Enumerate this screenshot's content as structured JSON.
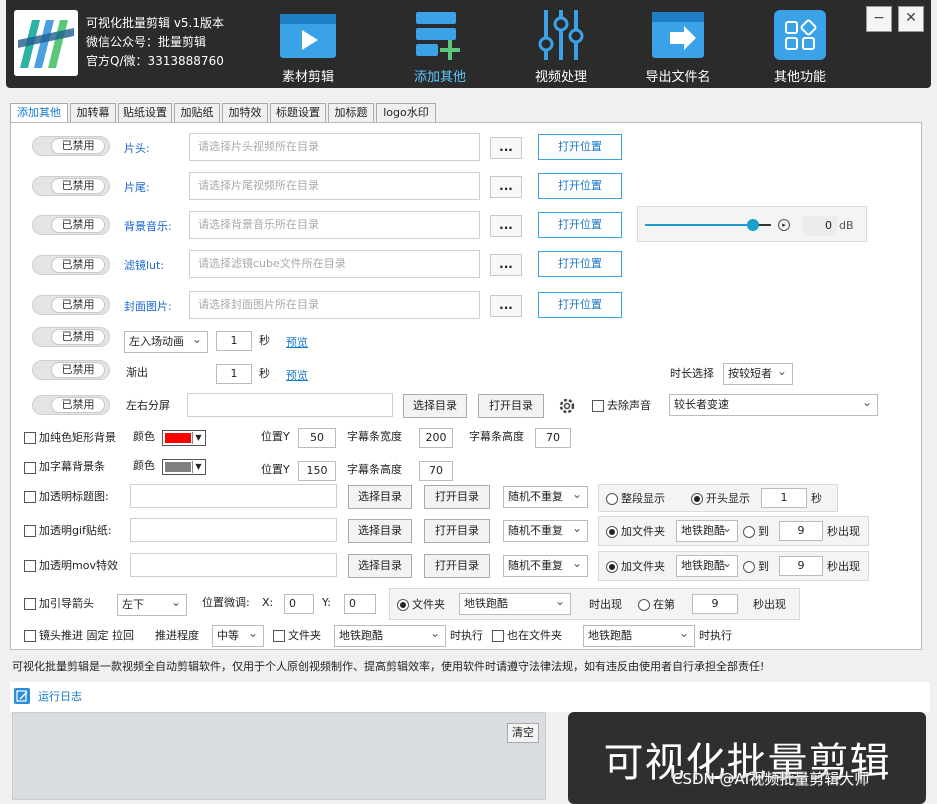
{
  "header": {
    "app_title": "可视化批量剪辑 v5.1版本",
    "wechat": "微信公众号：批量剪辑",
    "contact": "官方Q/微：3313888760",
    "nav": [
      {
        "label": "素材剪辑",
        "icon": "video-play-icon"
      },
      {
        "label": "添加其他",
        "icon": "add-list-icon"
      },
      {
        "label": "视频处理",
        "icon": "sliders-icon"
      },
      {
        "label": "导出文件名",
        "icon": "export-file-icon"
      },
      {
        "label": "其他功能",
        "icon": "grid-apps-icon"
      }
    ],
    "active_nav": "添加其他",
    "minimize": "−",
    "close": "✕"
  },
  "tabs": [
    "添加其他",
    "加转幕",
    "贴纸设置",
    "加贴纸",
    "加特效",
    "标题设置",
    "加标题",
    "logo水印"
  ],
  "rows": {
    "disabled_label": "已禁用",
    "head": {
      "label": "片头:",
      "placeholder": "请选择片头视频所在目录"
    },
    "tail": {
      "label": "片尾:",
      "placeholder": "请选择片尾视频所在目录"
    },
    "bgm": {
      "label": "背景音乐:",
      "placeholder": "请选择背景音乐所在目录",
      "db_value": "0",
      "db_unit": "dB"
    },
    "lut": {
      "label": "滤镜lut:",
      "placeholder": "请选择滤镜cube文件所在目录"
    },
    "cover": {
      "label": "封面图片:",
      "placeholder": "请选择封面图片所在目录"
    },
    "dots": "...",
    "open_location": "打开位置",
    "entry_anim": {
      "select": "左入场动画",
      "value": "1",
      "unit": "秒",
      "preview": "预览"
    },
    "fade_out": {
      "label": "渐出",
      "value": "1",
      "unit": "秒",
      "preview": "预览",
      "duration_label": "时长选择",
      "duration_select": "按较短者"
    },
    "split": {
      "label": "左右分屏",
      "choose_dir": "选择目录",
      "open_dir": "打开目录",
      "remove_audio": "去除声音",
      "speed_select": "较长者变速"
    }
  },
  "color_rect": {
    "label": "加纯色矩形背景",
    "color_label": "颜色",
    "color": "#ff0000",
    "pos_y_label": "位置Y",
    "pos_y": "50",
    "width_label": "字幕条宽度",
    "width": "200",
    "height_label": "字幕条高度",
    "height": "70"
  },
  "subtitle_bg": {
    "label": "加字幕背景条",
    "color_label": "颜色",
    "color": "#808080",
    "pos_y_label": "位置Y",
    "pos_y": "150",
    "height_label": "字幕条高度",
    "height": "70"
  },
  "trans_title": {
    "label": "加透明标题图:",
    "choose_dir": "选择目录",
    "open_dir": "打开目录",
    "random": "随机不重复",
    "opt1": "整段显示",
    "opt2": "开头显示",
    "seconds": "1",
    "unit": "秒"
  },
  "trans_gif": {
    "label": "加透明gif贴纸:",
    "choose_dir": "选择目录",
    "open_dir": "打开目录",
    "random": "随机不重复",
    "folder": "加文件夹",
    "folder_select": "地铁跑酷",
    "to": "到",
    "seconds": "9",
    "suffix": "秒出现"
  },
  "trans_mov": {
    "label": "加透明mov特效",
    "choose_dir": "选择目录",
    "open_dir": "打开目录",
    "random": "随机不重复",
    "folder": "加文件夹",
    "folder_select": "地铁跑酷",
    "to": "到",
    "seconds": "9",
    "suffix": "秒出现"
  },
  "guide_arrow": {
    "label": "加引导箭头",
    "pos_select": "左下",
    "offset_label": "位置微调:",
    "x_label": "X:",
    "x": "0",
    "y_label": "Y:",
    "y": "0",
    "folder": "文件夹",
    "folder_select": "地铁跑酷",
    "appear": "时出现",
    "at": "在第",
    "seconds": "9",
    "suffix": "秒出现"
  },
  "push_zoom": {
    "label": "镜头推进 固定 拉回",
    "degree_label": "推进程度",
    "degree": "中等",
    "folder": "文件夹",
    "folder_select": "地铁跑酷",
    "exec": "时执行",
    "also_folder": "也在文件夹",
    "also_select": "地铁跑酷",
    "exec2": "时执行"
  },
  "notice": "可视化批量剪辑是一款视频全自动剪辑软件，仅用于个人原创视频制作、提高剪辑效率，使用软件时请遵守法律法规，如有违反由使用者自行承担全部责任!",
  "log": {
    "title": "运行日志",
    "clear": "清空"
  },
  "brand": {
    "text": "可视化批量剪辑",
    "watermark": "CSDN @AI视频批量剪辑大师"
  },
  "colors": {
    "accent": "#1877c9",
    "header_bg": "#2b2b2b",
    "nav_active": "#5cc8ff"
  }
}
